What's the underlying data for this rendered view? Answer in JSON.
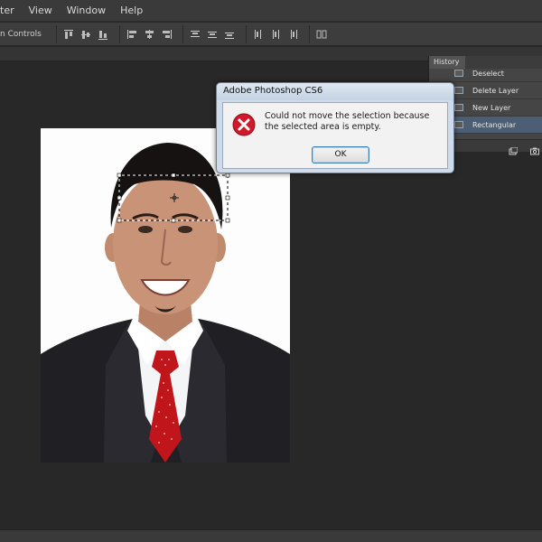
{
  "menubar": {
    "items": [
      "ter",
      "View",
      "Window",
      "Help"
    ]
  },
  "options": {
    "label": "n Controls"
  },
  "history": {
    "tab_label": "History",
    "rows": [
      "Deselect",
      "Delete Layer",
      "New Layer",
      "Rectangular Marquee"
    ],
    "selected_index": 3
  },
  "dialog": {
    "title": "Adobe Photoshop CS6",
    "message": "Could not move the selection because the selected area is empty.",
    "ok_label": "OK",
    "icon": "error-icon"
  },
  "colors": {
    "workspace": "#282828",
    "menubar": "#3a3a3a",
    "selection_highlight": "#4b5e73",
    "dialog_bg": "#cfdbe9",
    "error_red": "#d0192b",
    "tie_red": "#c1151c",
    "suit": "#1f1f24"
  }
}
